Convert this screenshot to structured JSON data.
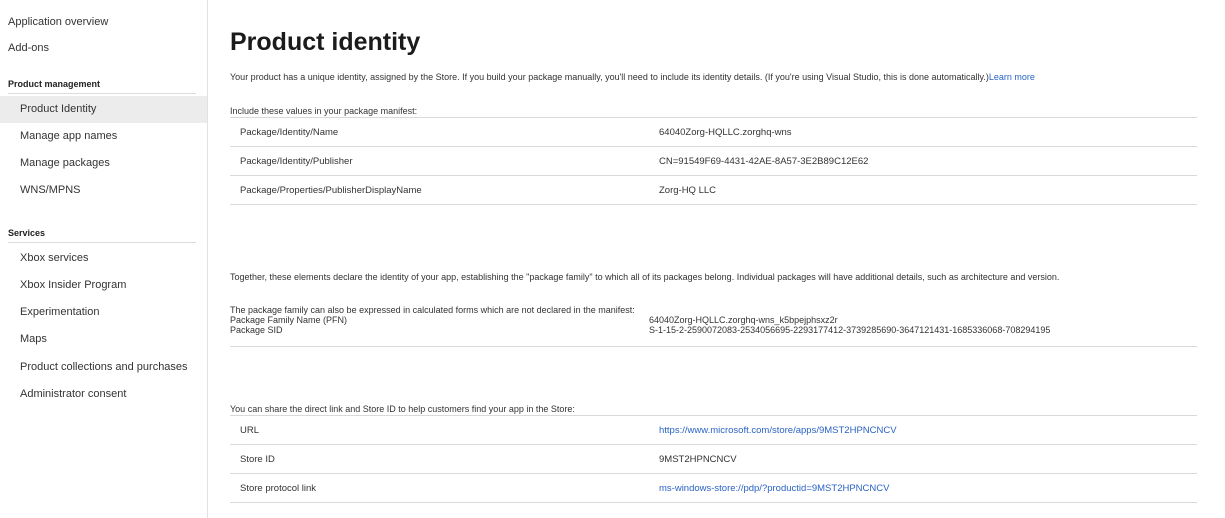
{
  "sidebar": {
    "top_items": [
      {
        "label": "Application overview"
      },
      {
        "label": "Add-ons"
      }
    ],
    "sections": [
      {
        "heading": "Product management",
        "items": [
          {
            "label": "Product Identity",
            "selected": true
          },
          {
            "label": "Manage app names"
          },
          {
            "label": "Manage packages"
          },
          {
            "label": "WNS/MPNS"
          }
        ]
      },
      {
        "heading": "Services",
        "items": [
          {
            "label": "Xbox services"
          },
          {
            "label": "Xbox Insider Program"
          },
          {
            "label": "Experimentation"
          },
          {
            "label": "Maps"
          },
          {
            "label": "Product collections and purchases"
          },
          {
            "label": "Administrator consent"
          }
        ]
      }
    ]
  },
  "main": {
    "title": "Product identity",
    "intro_text": "Your product has a unique identity, assigned by the Store. If you build your package manually, you'll need to include its identity details. (If you're using Visual Studio, this is done automatically.)",
    "learn_more": "Learn more",
    "manifest_label": "Include these values in your package manifest:",
    "manifest_rows": [
      {
        "key": "Package/Identity/Name",
        "value": "64040Zorg-HQLLC.zorghq-wns"
      },
      {
        "key": "Package/Identity/Publisher",
        "value": "CN=91549F69-4431-42AE-8A57-3E2B89C12E62"
      },
      {
        "key": "Package/Properties/PublisherDisplayName",
        "value": "Zorg-HQ LLC"
      }
    ],
    "together_text": "Together, these elements declare the identity of your app, establishing the \"package family\" to which all of its packages belong. Individual packages will have additional details, such as architecture and version.",
    "calc_label": "The package family can also be expressed in calculated forms which are not declared in the manifest:",
    "calc_rows": [
      {
        "key": "Package Family Name (PFN)",
        "value": "64040Zorg-HQLLC.zorghq-wns_k5bpejphsxz2r"
      },
      {
        "key": "Package SID",
        "value": "S-1-15-2-2590072083-2534056695-2293177412-3739285690-3647121431-1685336068-708294195"
      }
    ],
    "share_label": "You can share the direct link and Store ID to help customers find your app in the Store:",
    "share_rows": [
      {
        "key": "URL",
        "value": "https://www.microsoft.com/store/apps/9MST2HPNCNCV",
        "link": true
      },
      {
        "key": "Store ID",
        "value": "9MST2HPNCNCV",
        "link": false
      },
      {
        "key": "Store protocol link",
        "value": "ms-windows-store://pdp/?productid=9MST2HPNCNCV",
        "link": true
      }
    ]
  },
  "colors": {
    "link": "#2a63c5",
    "selected_nav_bg": "#ececec",
    "divider": "#d9d9d9"
  }
}
